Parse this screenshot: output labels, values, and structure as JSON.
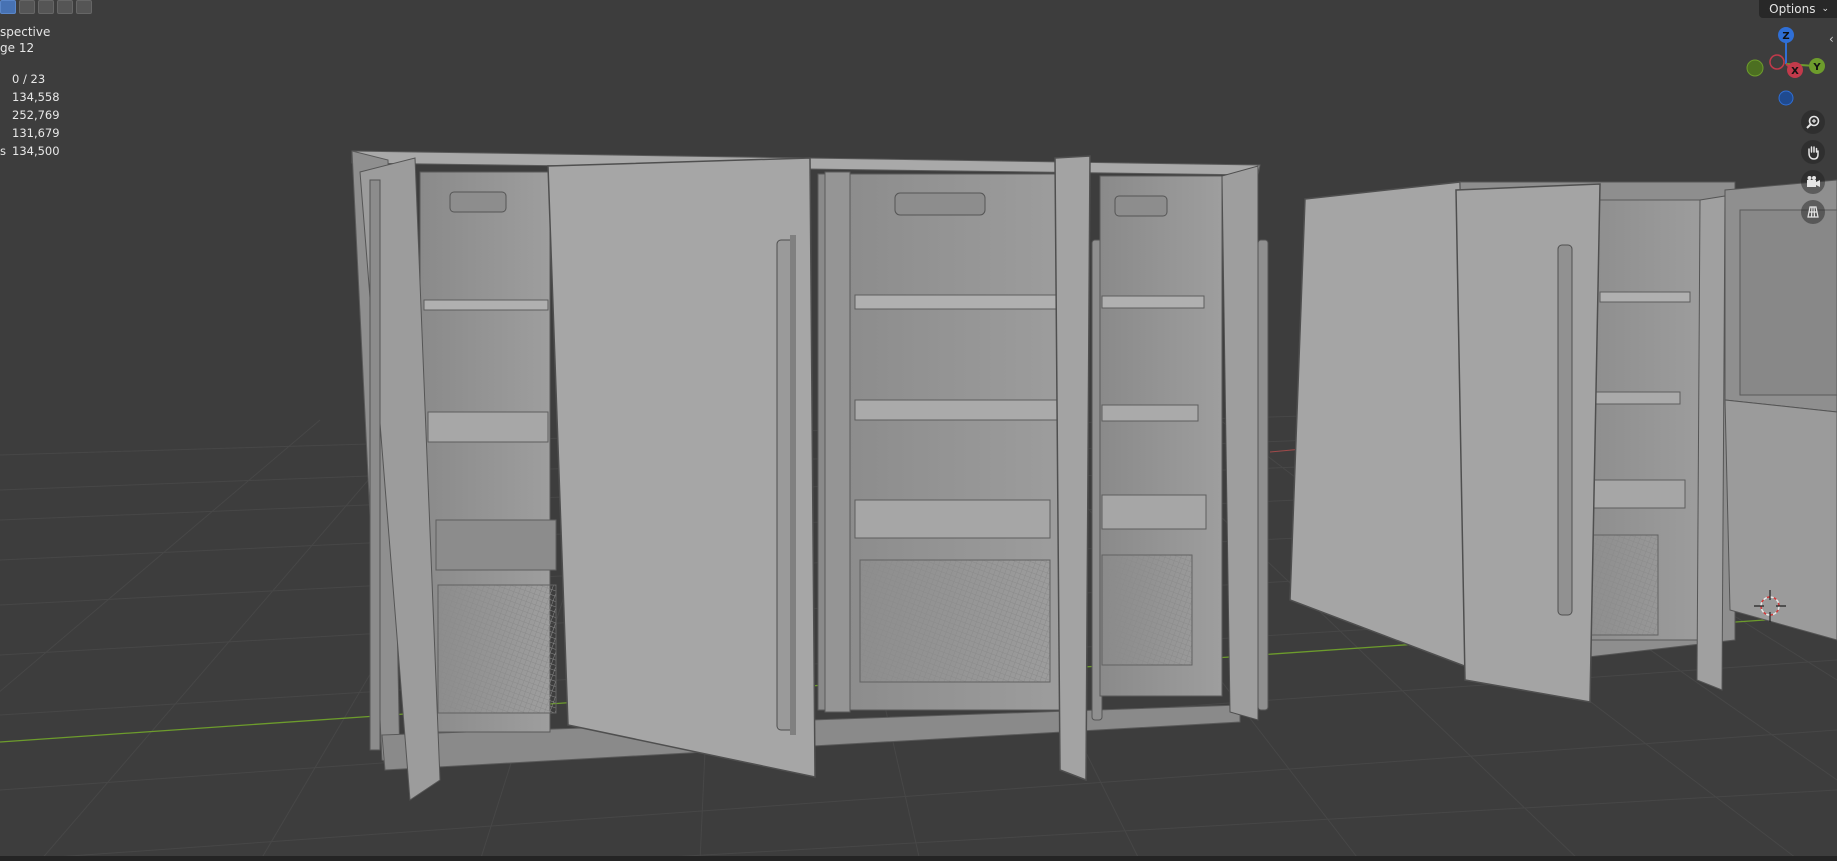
{
  "viewport": {
    "view_name": "spective",
    "collection_line": "ge 12",
    "stats": [
      {
        "label": "",
        "value": "0 / 23"
      },
      {
        "label": "",
        "value": "134,558"
      },
      {
        "label": "",
        "value": "252,769"
      },
      {
        "label": "",
        "value": "131,679"
      },
      {
        "label": "s",
        "value": "134,500"
      }
    ]
  },
  "header": {
    "options_label": "Options"
  },
  "gizmo": {
    "axis_z": "Z",
    "axis_y": "Y",
    "axis_x": "X"
  },
  "nav_icons": [
    "zoom-icon",
    "hand-pan-icon",
    "camera-icon",
    "grid-icon"
  ],
  "colors": {
    "background": "#3d3d3d",
    "grid": "#4a4a4a",
    "x_axis": "#a14a4a",
    "y_axis": "#6d9c2c",
    "z_axis": "#2f6fd6",
    "mesh": "#9a9a9a"
  }
}
